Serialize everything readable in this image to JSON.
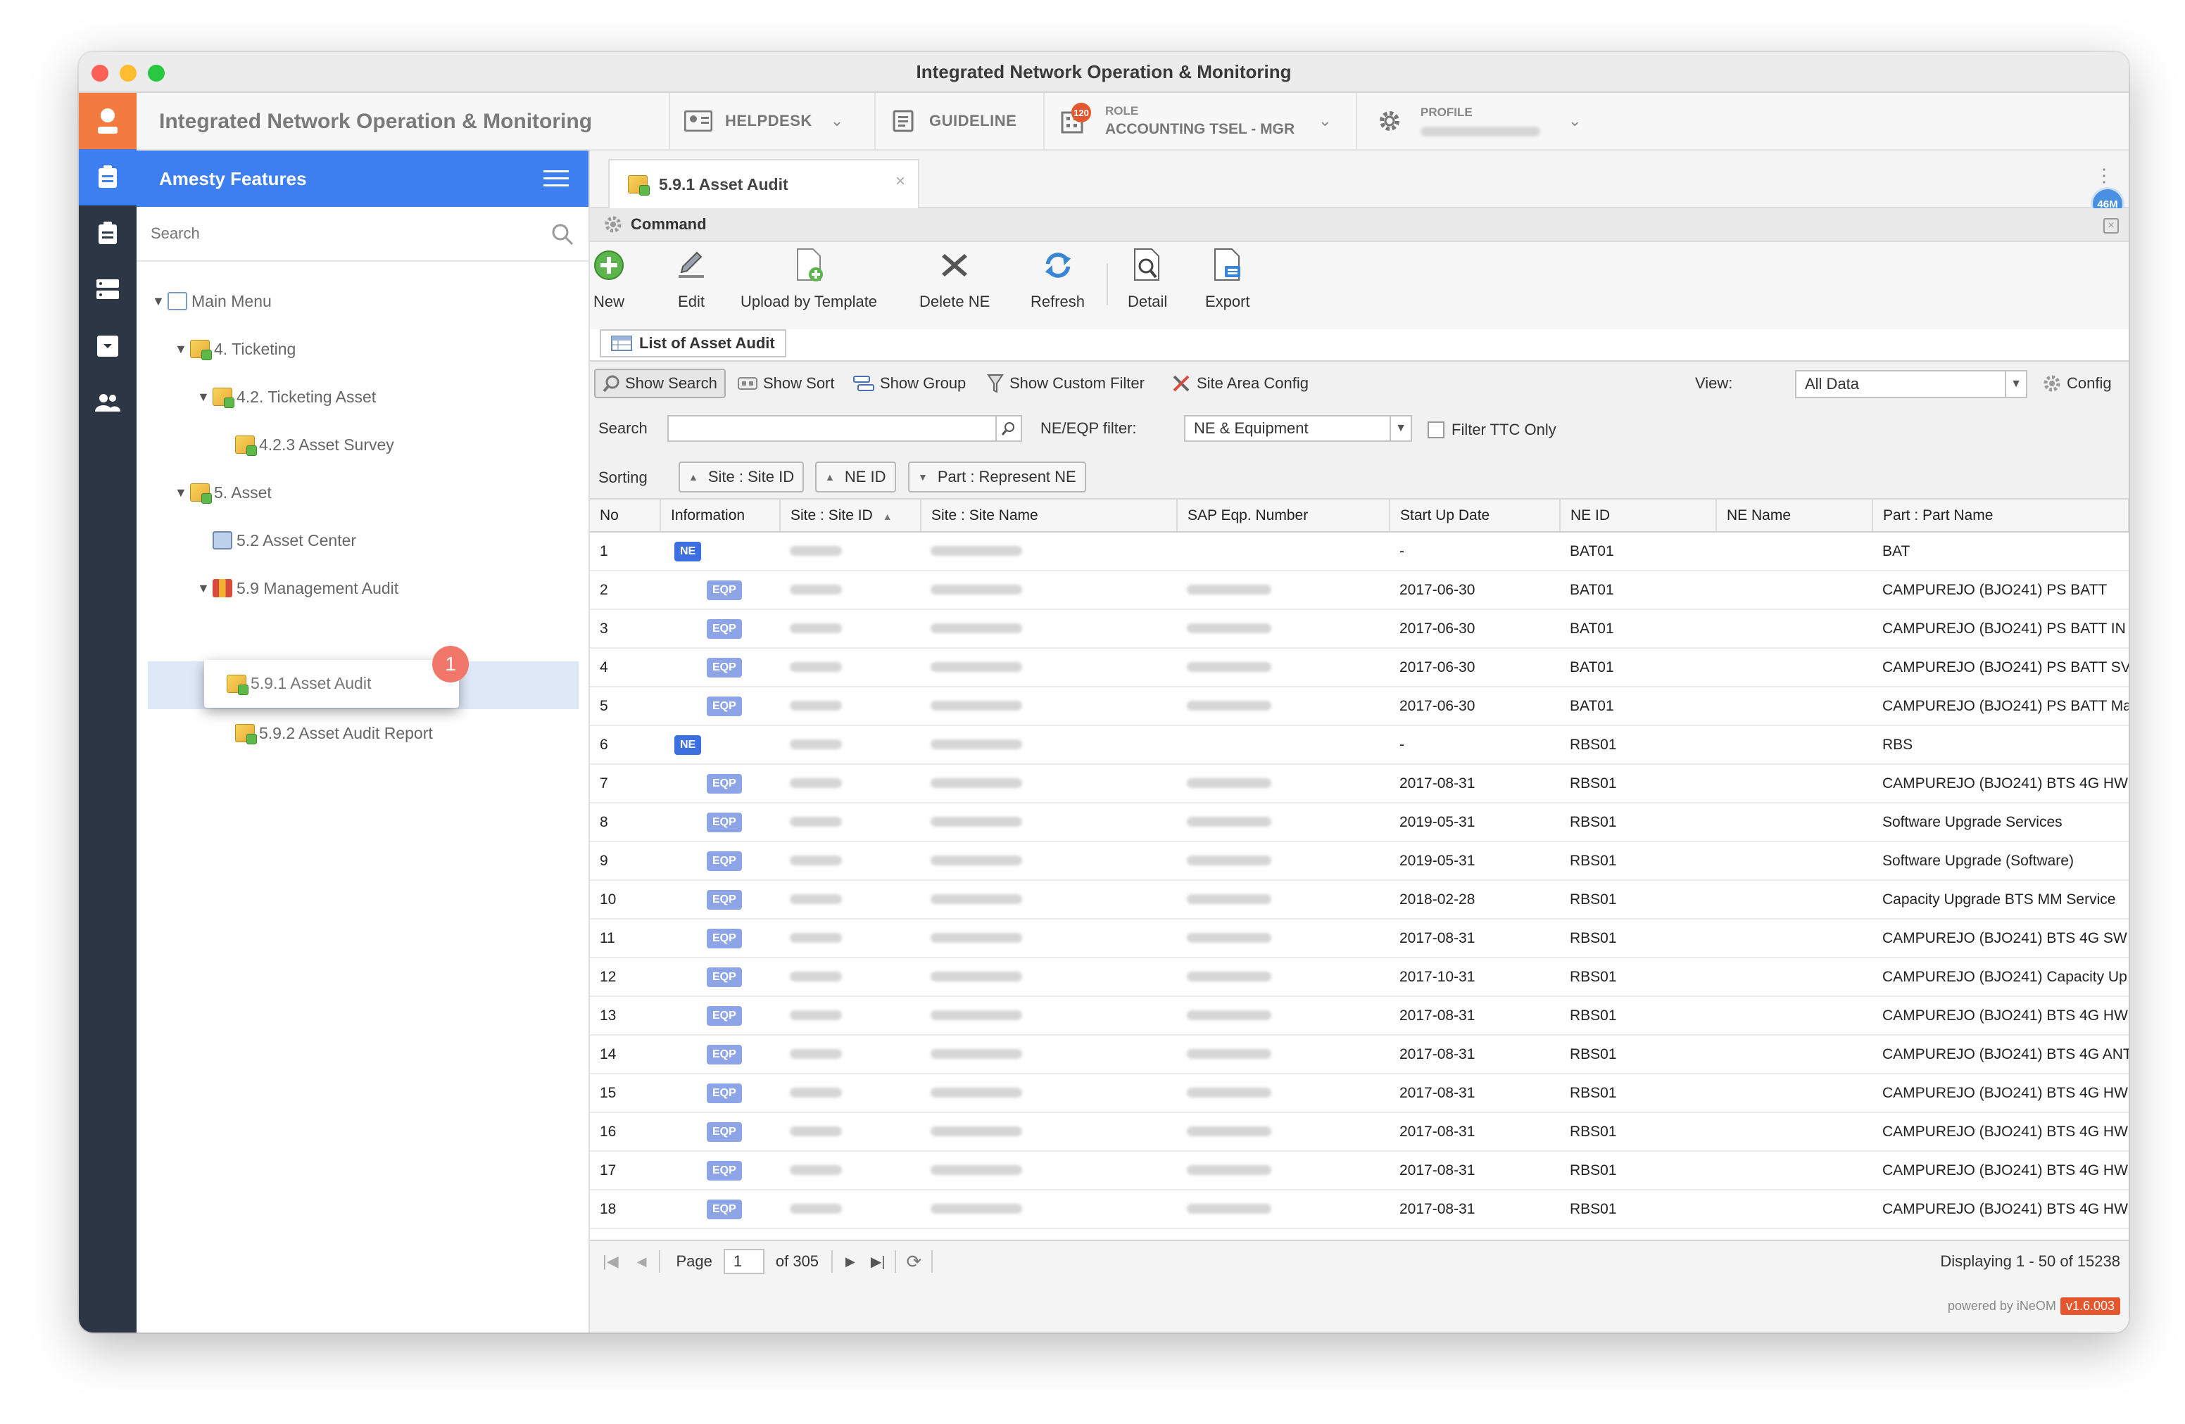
{
  "window": {
    "title": "Integrated Network Operation & Monitoring"
  },
  "header": {
    "app_title": "Integrated Network Operation & Monitoring",
    "helpdesk": "HELPDESK",
    "guideline": "GUIDELINE",
    "role_label": "ROLE",
    "role_value": "ACCOUNTING TSEL - MGR",
    "role_badge": "120",
    "profile_label": "PROFILE"
  },
  "sidebar": {
    "title": "Amesty Features",
    "search_placeholder": "Search",
    "tree": [
      {
        "label": "Main Menu",
        "icon": "menu"
      },
      {
        "label": "4. Ticketing",
        "icon": "folder"
      },
      {
        "label": "4.2. Ticketing Asset",
        "icon": "folder"
      },
      {
        "label": "4.2.3 Asset Survey",
        "icon": "folder"
      },
      {
        "label": "5. Asset",
        "icon": "folder"
      },
      {
        "label": "5.2 Asset Center",
        "icon": "monitor"
      },
      {
        "label": "5.9 Management Audit",
        "icon": "books"
      },
      {
        "label": "5.9.1 Asset Audit",
        "icon": "folder"
      },
      {
        "label": "5.9.2 Asset Audit Report",
        "icon": "folder"
      }
    ],
    "step_badge": "1"
  },
  "tab": {
    "label": "5.9.1 Asset Audit",
    "close": "×"
  },
  "memory_badge": "46M",
  "command": {
    "title": "Command",
    "buttons": [
      "New",
      "Edit",
      "Upload by Template",
      "Delete NE",
      "Refresh",
      "Detail",
      "Export"
    ]
  },
  "grid": {
    "panel_title": "List of Asset Audit",
    "options": [
      "Show Search",
      "Show Sort",
      "Show Group",
      "Show Custom Filter",
      "Site Area Config"
    ],
    "view_label": "View:",
    "view_value": "All Data",
    "config": "Config",
    "search_label": "Search",
    "search_value": "",
    "filter_label": "NE/EQP filter:",
    "filter_value": "NE & Equipment",
    "ttc_label": "Filter TTC Only",
    "sorting_label": "Sorting",
    "sort_chips": [
      "Site : Site ID",
      "NE ID",
      "Part : Represent NE"
    ],
    "columns": [
      "No",
      "Information",
      "Site : Site ID",
      "Site : Site Name",
      "SAP Eqp. Number",
      "Start Up Date",
      "NE ID",
      "NE Name",
      "Part : Part Name"
    ],
    "rows": [
      {
        "no": "1",
        "info": "NE",
        "date": "-",
        "ne_id": "BAT01",
        "part": "BAT",
        "sap": false
      },
      {
        "no": "2",
        "info": "EQP",
        "date": "2017-06-30",
        "ne_id": "BAT01",
        "part": "CAMPUREJO (BJO241) PS BATT",
        "sap": true
      },
      {
        "no": "3",
        "info": "EQP",
        "date": "2017-06-30",
        "ne_id": "BAT01",
        "part": "CAMPUREJO (BJO241) PS BATT IN",
        "sap": true
      },
      {
        "no": "4",
        "info": "EQP",
        "date": "2017-06-30",
        "ne_id": "BAT01",
        "part": "CAMPUREJO (BJO241) PS BATT SV",
        "sap": true
      },
      {
        "no": "5",
        "info": "EQP",
        "date": "2017-06-30",
        "ne_id": "BAT01",
        "part": "CAMPUREJO (BJO241) PS BATT Ma",
        "sap": true
      },
      {
        "no": "6",
        "info": "NE",
        "date": "-",
        "ne_id": "RBS01",
        "part": "RBS",
        "sap": false
      },
      {
        "no": "7",
        "info": "EQP",
        "date": "2017-08-31",
        "ne_id": "RBS01",
        "part": "CAMPUREJO (BJO241) BTS 4G HW",
        "sap": true
      },
      {
        "no": "8",
        "info": "EQP",
        "date": "2019-05-31",
        "ne_id": "RBS01",
        "part": "Software Upgrade Services",
        "sap": true
      },
      {
        "no": "9",
        "info": "EQP",
        "date": "2019-05-31",
        "ne_id": "RBS01",
        "part": "Software Upgrade (Software)",
        "sap": true
      },
      {
        "no": "10",
        "info": "EQP",
        "date": "2018-02-28",
        "ne_id": "RBS01",
        "part": "Capacity Upgrade BTS MM Service",
        "sap": true
      },
      {
        "no": "11",
        "info": "EQP",
        "date": "2017-08-31",
        "ne_id": "RBS01",
        "part": "CAMPUREJO (BJO241) BTS 4G SW",
        "sap": true
      },
      {
        "no": "12",
        "info": "EQP",
        "date": "2017-10-31",
        "ne_id": "RBS01",
        "part": "CAMPUREJO (BJO241) Capacity Up",
        "sap": true
      },
      {
        "no": "13",
        "info": "EQP",
        "date": "2017-08-31",
        "ne_id": "RBS01",
        "part": "CAMPUREJO (BJO241) BTS 4G HW",
        "sap": true
      },
      {
        "no": "14",
        "info": "EQP",
        "date": "2017-08-31",
        "ne_id": "RBS01",
        "part": "CAMPUREJO (BJO241) BTS 4G ANT",
        "sap": true
      },
      {
        "no": "15",
        "info": "EQP",
        "date": "2017-08-31",
        "ne_id": "RBS01",
        "part": "CAMPUREJO (BJO241) BTS 4G HW",
        "sap": true
      },
      {
        "no": "16",
        "info": "EQP",
        "date": "2017-08-31",
        "ne_id": "RBS01",
        "part": "CAMPUREJO (BJO241) BTS 4G HW",
        "sap": true
      },
      {
        "no": "17",
        "info": "EQP",
        "date": "2017-08-31",
        "ne_id": "RBS01",
        "part": "CAMPUREJO (BJO241) BTS 4G HW",
        "sap": true
      },
      {
        "no": "18",
        "info": "EQP",
        "date": "2017-08-31",
        "ne_id": "RBS01",
        "part": "CAMPUREJO (BJO241) BTS 4G HW",
        "sap": true
      }
    ]
  },
  "pager": {
    "page_label": "Page",
    "page_value": "1",
    "of_label": "of 305",
    "displaying": "Displaying 1 - 50 of 15238"
  },
  "footer": {
    "powered": "powered by iNeOM",
    "version": "v1.6.003"
  },
  "colors": {
    "accent": "#3d7ef0",
    "rail": "#2d3645",
    "logo": "#f47b3f",
    "badge_ne": "#3d6fe0",
    "badge_eqp": "#8da5e6"
  }
}
